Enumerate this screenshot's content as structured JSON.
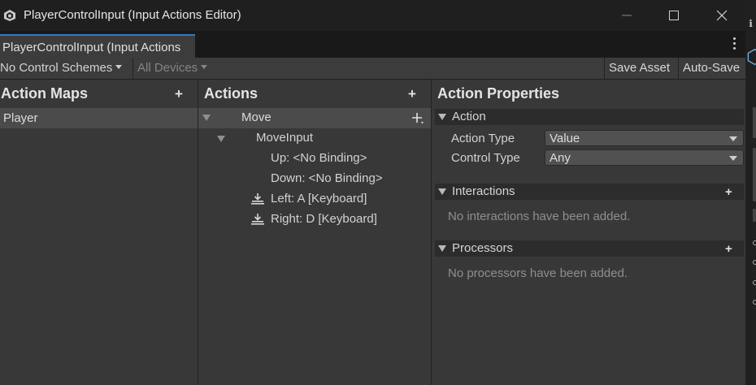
{
  "window": {
    "title": "PlayerControlInput (Input Actions Editor)"
  },
  "tab": {
    "label": "PlayerControlInput (Input Actions"
  },
  "toolbar": {
    "control_schemes": "No Control Schemes",
    "devices": "All Devices",
    "save_asset": "Save Asset",
    "auto_save": "Auto-Save"
  },
  "action_maps": {
    "title": "Action Maps",
    "add_label": "+",
    "items": [
      {
        "label": "Player",
        "selected": true
      }
    ]
  },
  "actions": {
    "title": "Actions",
    "add_label": "+",
    "tree": {
      "action": "Move",
      "composite": "MoveInput",
      "bindings": [
        "Up: <No Binding>",
        "Down: <No Binding>",
        "Left: A [Keyboard]",
        "Right: D [Keyboard]"
      ]
    }
  },
  "properties": {
    "title": "Action Properties",
    "action_section": "Action",
    "action_type_label": "Action Type",
    "action_type_value": "Value",
    "control_type_label": "Control Type",
    "control_type_value": "Any",
    "interactions_section": "Interactions",
    "interactions_empty": "No interactions have been added.",
    "processors_section": "Processors",
    "processors_empty": "No processors have been added.",
    "add_label": "+"
  },
  "colors": {
    "accent": "#3a79bb",
    "selected_row": "#4b4b4b",
    "panel": "#383838"
  },
  "icons": [
    "unity-input-icon",
    "minimize-icon",
    "maximize-icon",
    "close-icon",
    "kebab-menu-icon",
    "keyboard-binding-icon",
    "add-binding-icon",
    "info-icon"
  ]
}
